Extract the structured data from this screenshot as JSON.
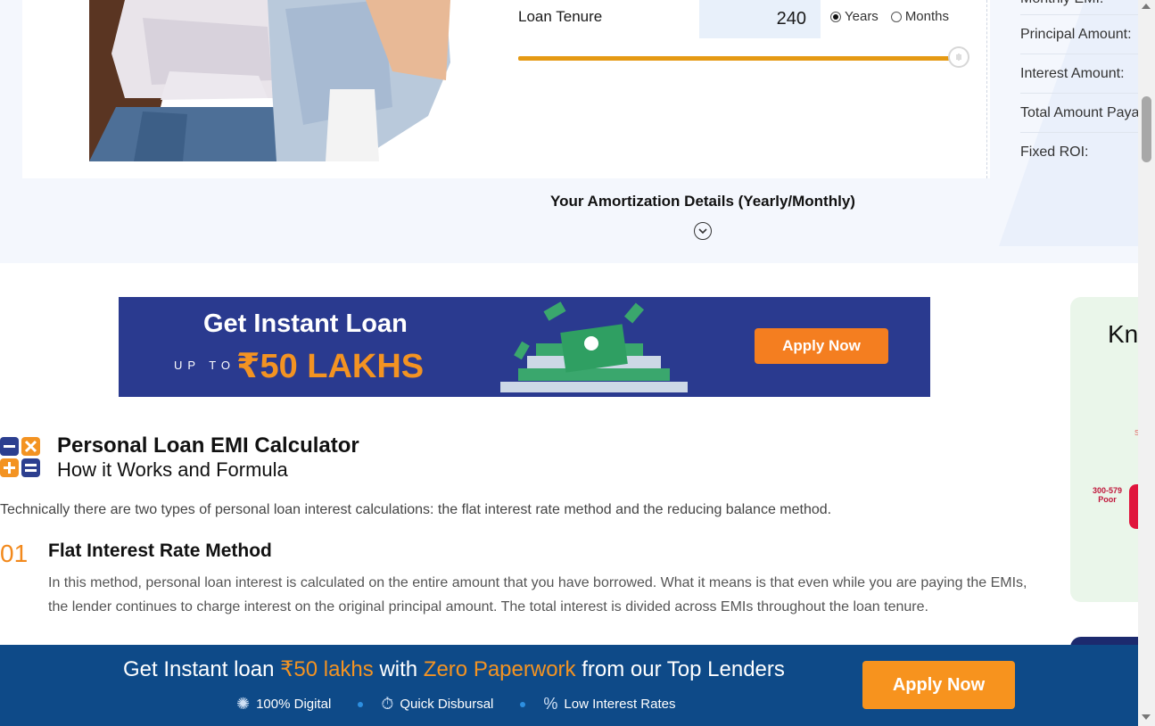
{
  "calculator": {
    "tenure_label": "Loan Tenure",
    "tenure_value": "240",
    "unit_years": "Years",
    "unit_months": "Months",
    "selected_unit": "Years",
    "slider_level": 1.0
  },
  "summary": {
    "rows": [
      "Monthly EMI:",
      "Principal Amount:",
      "Interest Amount:",
      "Total Amount Payable:",
      "Fixed ROI:"
    ]
  },
  "amortization": {
    "title": "Your Amortization Details (Yearly/Monthly)"
  },
  "promo_banner": {
    "headline": "Get Instant Loan",
    "upto": "UP TO",
    "amount": "₹50 LAKHS",
    "button": "Apply Now"
  },
  "side_card": {
    "heading": "Kn",
    "score_range": "300-579",
    "score_label": "Poor"
  },
  "article": {
    "title": "Personal Loan EMI Calculator",
    "subtitle": "How it Works and Formula",
    "intro": "Technically there are two types of personal loan interest calculations: the flat interest rate method and the reducing balance method.",
    "method_number": "01",
    "method_title": "Flat Interest Rate Method",
    "method_body": "In this method, personal loan interest is calculated on the entire amount that you have borrowed. What it means is that even while you are paying the EMIs, the lender continues to charge interest on the original principal amount. The total interest is divided across EMIs throughout the loan tenure."
  },
  "bottom_bar": {
    "text_a": "Get Instant loan ",
    "text_b": "₹50 lakhs",
    "text_c": " with ",
    "text_d": "Zero Paperwork",
    "text_e": " from our Top Lenders",
    "features": [
      "100% Digital",
      "Quick Disbursal",
      "Low Interest Rates"
    ],
    "button": "Apply Now"
  },
  "colors": {
    "accent_orange": "#f7931e",
    "bar_blue": "#0e4a88",
    "banner_navy": "#2a3a8f",
    "slider": "#e59a14"
  }
}
